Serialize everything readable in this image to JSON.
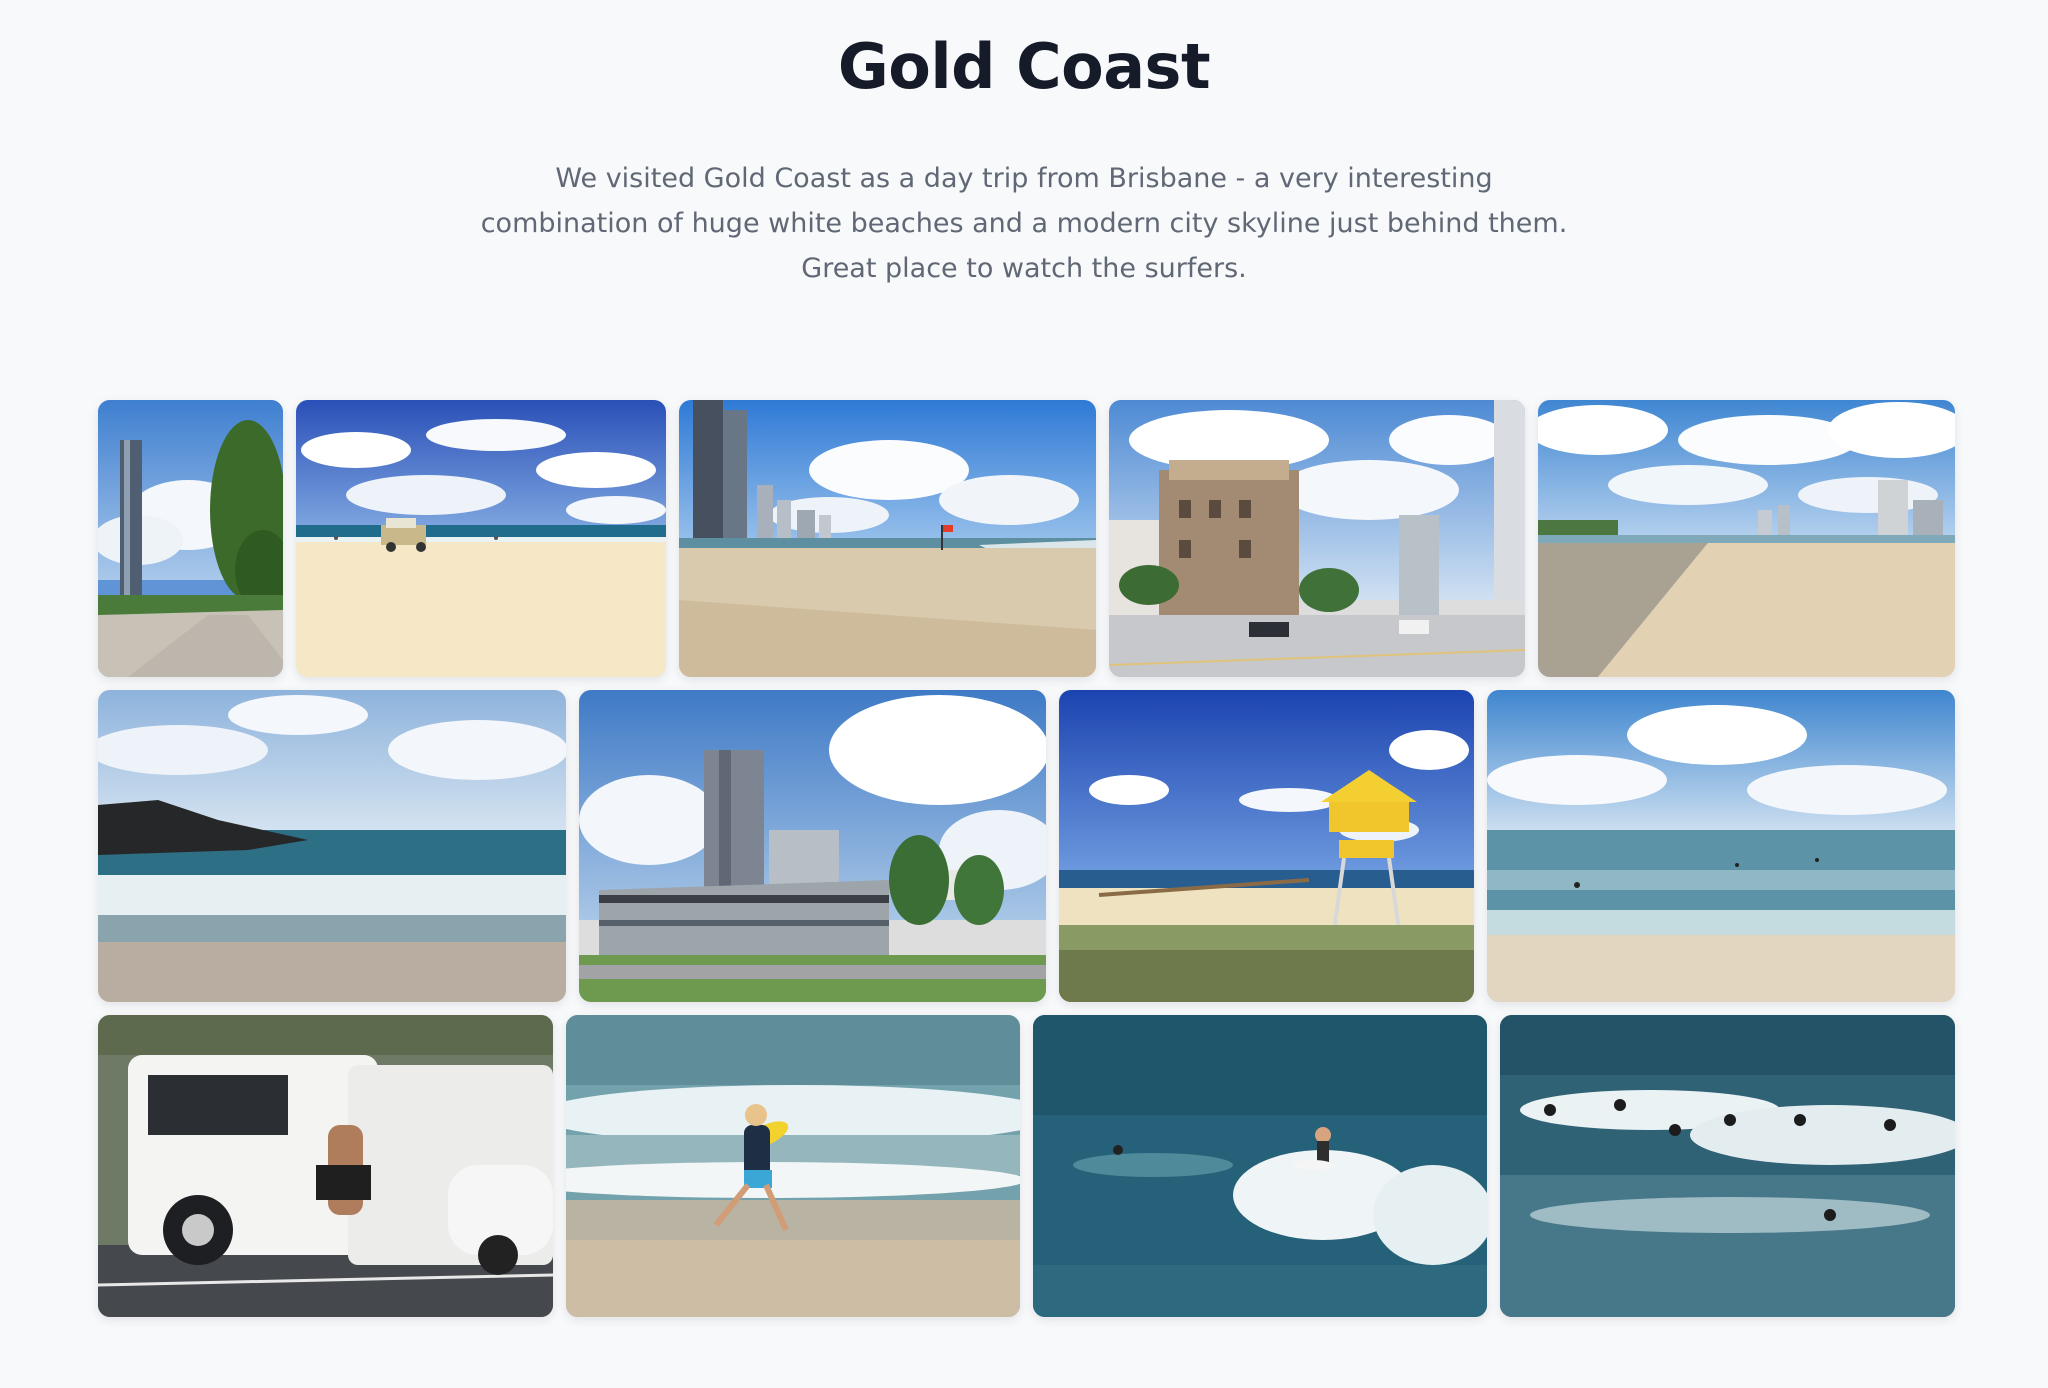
{
  "page": {
    "title": "Gold Coast",
    "description": "We visited Gold Coast as a day trip from Brisbane - a very interesting combination of huge white beaches and a modern city skyline just behind them. Great place to watch the surfers."
  },
  "gallery": {
    "photos": [
      {
        "subject": "beachfront-promenade-with-tower"
      },
      {
        "subject": "lifeguard-truck-on-white-sand"
      },
      {
        "subject": "surfers-paradise-beach-skyline"
      },
      {
        "subject": "historic-building-street-corner"
      },
      {
        "subject": "wide-beach-with-distant-towers"
      },
      {
        "subject": "rocky-breakwater-with-distant-skyline"
      },
      {
        "subject": "coolangatta-high-rise-and-palms"
      },
      {
        "subject": "lifeguard-tower-on-dunes"
      },
      {
        "subject": "shallow-surf-beach"
      },
      {
        "subject": "surfer-sitting-on-ute-tailgate"
      },
      {
        "subject": "child-running-with-boogie-board"
      },
      {
        "subject": "surfer-riding-wave"
      },
      {
        "subject": "group-of-surfers-in-waves"
      }
    ]
  }
}
